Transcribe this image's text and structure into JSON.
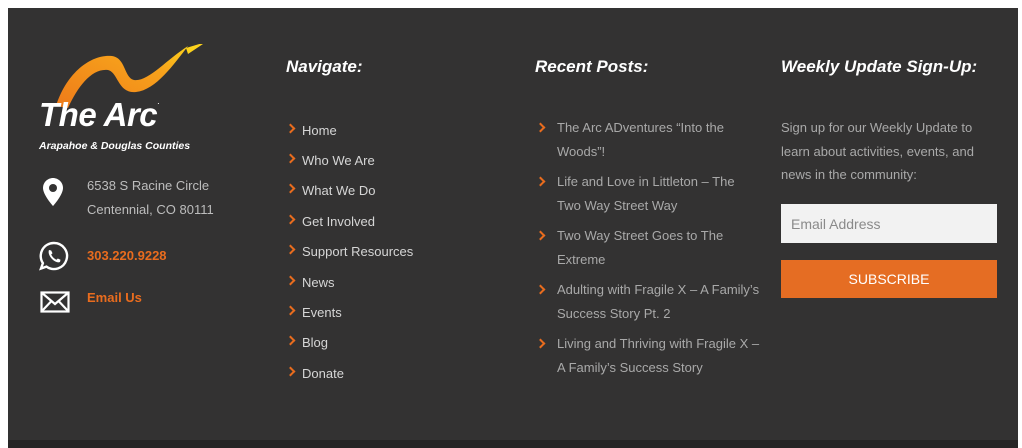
{
  "colors": {
    "accent": "#e96c1e",
    "background": "#333232",
    "heading": "#ffffff",
    "body_text": "#a9a9a9",
    "nav_text": "#d6d6d6"
  },
  "brand": {
    "name": "The Arc",
    "tm": ".",
    "subtitle": "Arapahoe & Douglas Counties",
    "logo_icon": "arc-swoosh-logo"
  },
  "contact": {
    "address_line1": "6538 S Racine Circle",
    "address_line2": "Centennial, CO 80111",
    "phone": "303.220.9228",
    "email_label": "Email Us",
    "icons": [
      "location-pin-icon",
      "whatsapp-phone-icon",
      "envelope-icon"
    ]
  },
  "navigate": {
    "heading": "Navigate:",
    "items": [
      "Home",
      "Who We Are",
      "What We Do",
      "Get Involved",
      "Support Resources",
      "News",
      "Events",
      "Blog",
      "Donate"
    ]
  },
  "posts": {
    "heading": "Recent Posts:",
    "items": [
      "The Arc ADventures “Into the Woods”!",
      "Life and Love in Littleton – The Two Way Street Way",
      "Two Way Street Goes to The Extreme",
      "Adulting with Fragile X – A Family’s Success Story Pt. 2",
      "Living and Thriving with Fragile X – A Family’s Success Story"
    ]
  },
  "signup": {
    "heading": "Weekly Update Sign-Up:",
    "text": "Sign up for our Weekly Update to learn about activities, events, and news in the community:",
    "email_placeholder": "Email Address",
    "button_label": "SUBSCRIBE"
  }
}
